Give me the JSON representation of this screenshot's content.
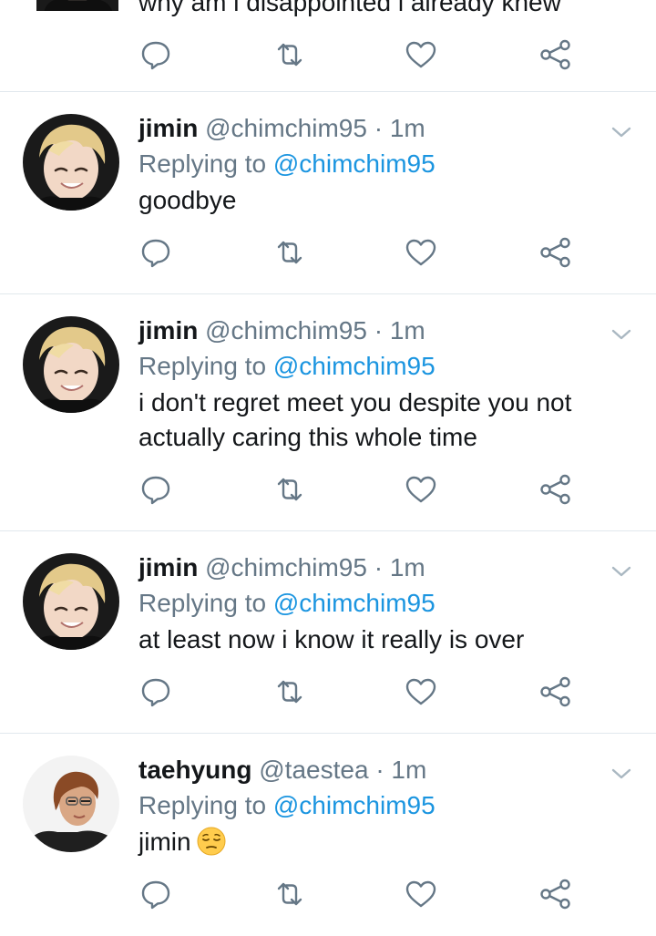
{
  "tweets": [
    {
      "partial": true,
      "text": "why am i disappointed i already knew"
    },
    {
      "name": "jimin",
      "handle": "@chimchim95",
      "separator": "·",
      "time": "1m",
      "replying_prefix": "Replying to",
      "replying_to": "@chimchim95",
      "text": "goodbye",
      "avatar": "blonde-boy-avatar"
    },
    {
      "name": "jimin",
      "handle": "@chimchim95",
      "separator": "·",
      "time": "1m",
      "replying_prefix": "Replying to",
      "replying_to": "@chimchim95",
      "text_lines": [
        "i don't regret meet you despite you not",
        "actually caring this whole time"
      ],
      "avatar": "blonde-boy-avatar"
    },
    {
      "name": "jimin",
      "handle": "@chimchim95",
      "separator": "·",
      "time": "1m",
      "replying_prefix": "Replying to",
      "replying_to": "@chimchim95",
      "text": "at least now i know it really is over",
      "avatar": "blonde-boy-avatar"
    },
    {
      "name": "taehyung",
      "handle": "@taestea",
      "separator": "·",
      "time": "1m",
      "replying_prefix": "Replying to",
      "replying_to": "@chimchim95",
      "text": "jimin",
      "emoji": "pensive-face-emoji",
      "avatar": "brown-hair-boy-avatar"
    }
  ],
  "action_icons": [
    "reply-icon",
    "retweet-icon",
    "like-icon",
    "share-icon"
  ],
  "colors": {
    "text": "#14171a",
    "muted": "#657786",
    "link": "#1b95e0",
    "divider": "#e1e8ed"
  }
}
